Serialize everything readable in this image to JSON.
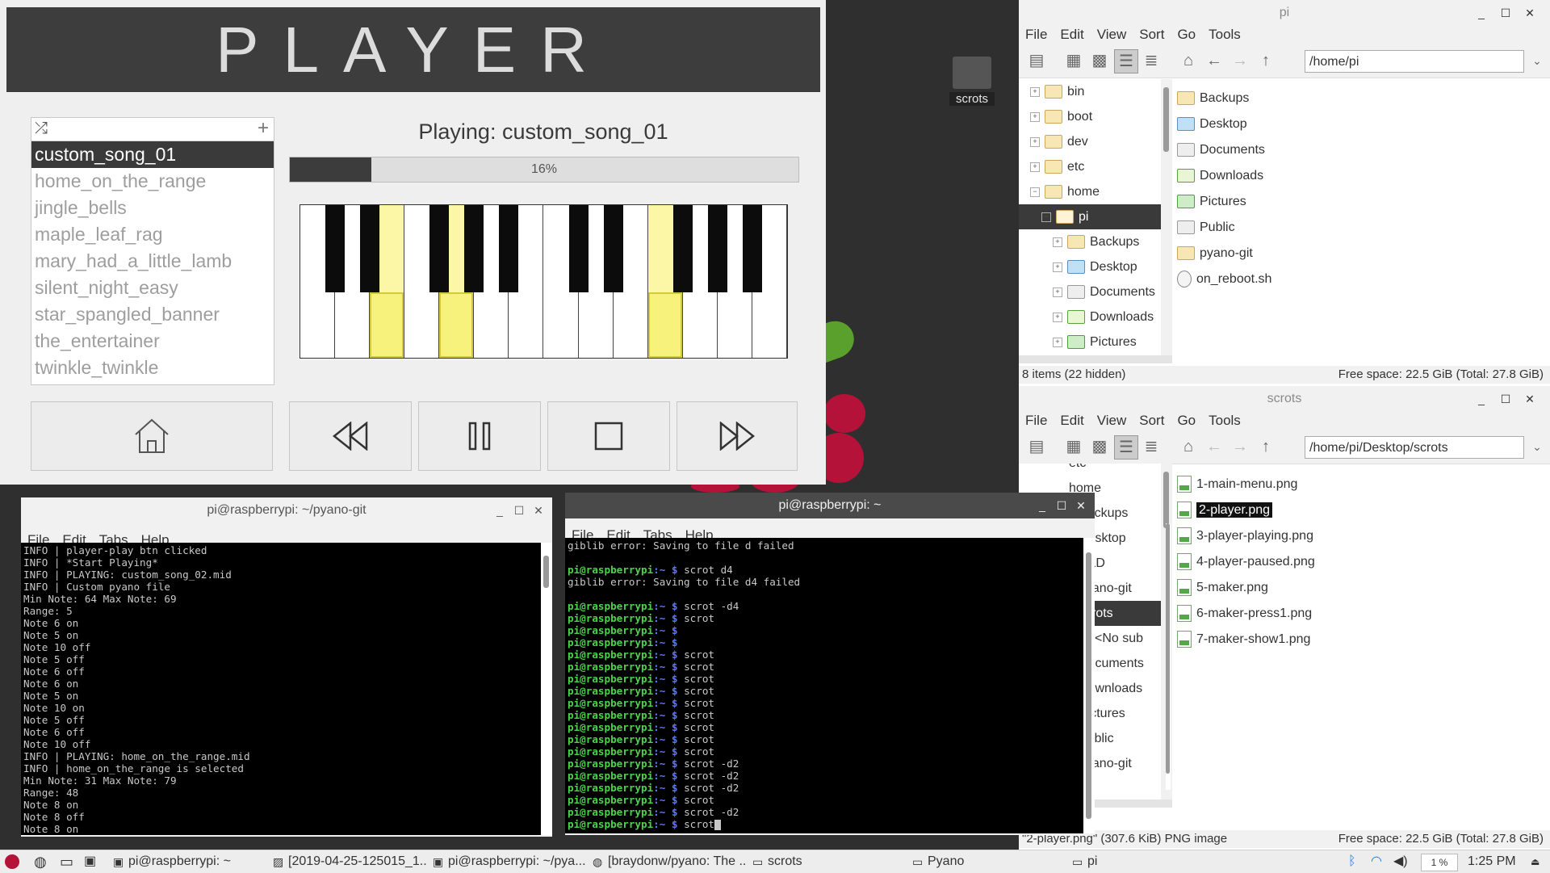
{
  "desktop": {
    "icon_label": "scrots"
  },
  "player": {
    "header_title": "PLAYER",
    "shuffle_icon": "shuffle-icon",
    "add_icon": "plus-icon",
    "songs": [
      "custom_song_01",
      "home_on_the_range",
      "jingle_bells",
      "maple_leaf_rag",
      "mary_had_a_little_lamb",
      "silent_night_easy",
      "star_spangled_banner",
      "the_entertainer",
      "twinkle_twinkle"
    ],
    "selected_song_index": 0,
    "playing_label": "Playing: custom_song_01",
    "progress_percent": 16,
    "progress_text": "16%",
    "highlighted_white_keys": [
      2,
      4,
      10
    ],
    "controls": [
      "home-icon",
      "rewind-icon",
      "pause-icon",
      "stop-icon",
      "fast-forward-icon"
    ]
  },
  "fm1": {
    "title": "pi",
    "menu": [
      "File",
      "Edit",
      "View",
      "Sort",
      "Go",
      "Tools"
    ],
    "path": "/home/pi",
    "tree": [
      {
        "label": "bin",
        "level": 0,
        "exp": "+"
      },
      {
        "label": "boot",
        "level": 0,
        "exp": "+"
      },
      {
        "label": "dev",
        "level": 0,
        "exp": "+"
      },
      {
        "label": "etc",
        "level": 0,
        "exp": "+"
      },
      {
        "label": "home",
        "level": 0,
        "exp": "−"
      },
      {
        "label": "pi",
        "level": 1,
        "exp": "−",
        "sel": true,
        "kind": "home"
      },
      {
        "label": "Backups",
        "level": 2,
        "exp": "+"
      },
      {
        "label": "Desktop",
        "level": 2,
        "exp": "+",
        "kind": "desk"
      },
      {
        "label": "Documents",
        "level": 2,
        "exp": "+",
        "kind": "doc"
      },
      {
        "label": "Downloads",
        "level": 2,
        "exp": "+",
        "kind": "dl"
      },
      {
        "label": "Pictures",
        "level": 2,
        "exp": "+",
        "kind": "pic"
      }
    ],
    "files": [
      {
        "name": "Backups",
        "kind": "folder"
      },
      {
        "name": "Desktop",
        "kind": "desk"
      },
      {
        "name": "Documents",
        "kind": "doc"
      },
      {
        "name": "Downloads",
        "kind": "dl"
      },
      {
        "name": "Pictures",
        "kind": "pic"
      },
      {
        "name": "Public",
        "kind": "doc"
      },
      {
        "name": "pyano-git",
        "kind": "folder"
      },
      {
        "name": "on_reboot.sh",
        "kind": "sh"
      }
    ],
    "status_left": "8 items (22 hidden)",
    "status_right": "Free space: 22.5 GiB (Total: 27.8 GiB)"
  },
  "fm2": {
    "title": "scrots",
    "menu": [
      "File",
      "Edit",
      "View",
      "Sort",
      "Go",
      "Tools"
    ],
    "path": "/home/pi/Desktop/scrots",
    "tree": [
      {
        "label": "etc"
      },
      {
        "label": "home"
      },
      {
        "label": "Backups"
      },
      {
        "label": "Desktop"
      },
      {
        "label": "OLD"
      },
      {
        "label": "pyano-git"
      },
      {
        "label": "scrots",
        "sel": true
      },
      {
        "label": "<No sub"
      },
      {
        "label": "Documents"
      },
      {
        "label": "Downloads"
      },
      {
        "label": "Pictures"
      },
      {
        "label": "Public"
      },
      {
        "label": "pyano-git"
      }
    ],
    "files": [
      "1-main-menu.png",
      "2-player.png",
      "3-player-playing.png",
      "4-player-paused.png",
      "5-maker.png",
      "6-maker-press1.png",
      "7-maker-show1.png"
    ],
    "selected_file_index": 1,
    "status_left": "\"2-player.png\" (307.6 KiB) PNG image",
    "status_right": "Free space: 22.5 GiB (Total: 27.8 GiB)"
  },
  "term1": {
    "title": "pi@raspberrypi: ~/pyano-git",
    "menu": [
      "File",
      "Edit",
      "Tabs",
      "Help"
    ],
    "lines": [
      "INFO | player-play btn clicked",
      "INFO | *Start Playing*",
      "INFO | PLAYING: custom_song_02.mid",
      "INFO | Custom pyano file",
      "Min Note: 64 Max Note: 69",
      "Range: 5",
      "Note 6 on",
      "Note 5 on",
      "Note 10 off",
      "Note 5 off",
      "Note 6 off",
      "Note 6 on",
      "Note 5 on",
      "Note 10 on",
      "Note 5 off",
      "Note 6 off",
      "Note 10 off",
      "INFO | PLAYING: home_on_the_range.mid",
      "INFO | home_on_the_range is selected",
      "Min Note: 31 Max Note: 79",
      "Range: 48",
      "Note 8 on",
      "Note 8 off",
      "Note 8 on"
    ]
  },
  "term2": {
    "title": "pi@raspberrypi: ~",
    "menu": [
      "File",
      "Edit",
      "Tabs",
      "Help"
    ],
    "prompt_user": "pi@raspberrypi",
    "prompt_path": ":~ $",
    "lines": [
      {
        "t": "out",
        "text": "giblib error: Saving to file d failed"
      },
      {
        "t": "out",
        "text": ""
      },
      {
        "t": "cmd",
        "text": " scrot d4"
      },
      {
        "t": "out",
        "text": "giblib error: Saving to file d4 failed"
      },
      {
        "t": "out",
        "text": ""
      },
      {
        "t": "cmd",
        "text": " scrot -d4"
      },
      {
        "t": "cmd",
        "text": " scrot"
      },
      {
        "t": "cmd",
        "text": ""
      },
      {
        "t": "cmd",
        "text": ""
      },
      {
        "t": "cmd",
        "text": " scrot"
      },
      {
        "t": "cmd",
        "text": " scrot"
      },
      {
        "t": "cmd",
        "text": " scrot"
      },
      {
        "t": "cmd",
        "text": " scrot"
      },
      {
        "t": "cmd",
        "text": " scrot"
      },
      {
        "t": "cmd",
        "text": " scrot"
      },
      {
        "t": "cmd",
        "text": " scrot"
      },
      {
        "t": "cmd",
        "text": " scrot"
      },
      {
        "t": "cmd",
        "text": " scrot"
      },
      {
        "t": "cmd",
        "text": " scrot -d2"
      },
      {
        "t": "cmd",
        "text": " scrot -d2"
      },
      {
        "t": "cmd",
        "text": " scrot -d2"
      },
      {
        "t": "cmd",
        "text": " scrot"
      },
      {
        "t": "cmd",
        "text": " scrot -d2"
      },
      {
        "t": "cmd",
        "text": " scrot",
        "cursor": true
      }
    ]
  },
  "taskbar": {
    "items": [
      {
        "label": "pi@raspberrypi: ~",
        "icon": "terminal-icon"
      },
      {
        "label": "[2019-04-25-125015_1...",
        "icon": "image-viewer-icon"
      },
      {
        "label": "pi@raspberrypi: ~/pya...",
        "icon": "terminal-icon"
      },
      {
        "label": "[braydonw/pyano: The ...",
        "icon": "browser-icon"
      },
      {
        "label": "scrots",
        "icon": "folder-icon"
      },
      {
        "label": "Pyano",
        "icon": "window-icon"
      },
      {
        "label": "pi",
        "icon": "folder-icon"
      }
    ],
    "cpu": "1 %",
    "clock": "1:25 PM"
  },
  "colors": {
    "accent_dark": "#3a3a3a",
    "key_highlight": "#f7f27c",
    "prompt_green": "#4bd44b",
    "prompt_blue": "#5a78ff",
    "raspberry": "#b5123a"
  }
}
